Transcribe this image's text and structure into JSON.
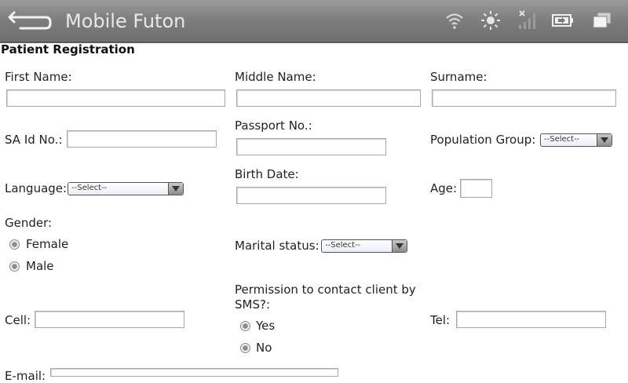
{
  "app": {
    "title": "Mobile Futon"
  },
  "page": {
    "title": "Patient Registration"
  },
  "status_icons": [
    "wifi-icon",
    "brightness-icon",
    "no-signal-icon",
    "battery-charging-icon",
    "recent-apps-icon"
  ],
  "form": {
    "first_name_label": "First Name:",
    "middle_name_label": "Middle Name:",
    "surname_label": "Surname:",
    "sa_id_label": "SA Id No.:",
    "passport_label": "Passport No.:",
    "population_group_label": "Population Group:",
    "population_group_value": "--Select--",
    "language_label": "Language:",
    "language_value": "--Select--",
    "birth_date_label": "Birth Date:",
    "age_label": "Age:",
    "gender_label": "Gender:",
    "gender_options": [
      "Female",
      "Male"
    ],
    "marital_status_label": "Marital status:",
    "marital_status_value": "--Select--",
    "sms_permission_label_line1": "Permission to contact client by",
    "sms_permission_label_line2": "SMS?:",
    "sms_options": [
      "Yes",
      "No"
    ],
    "cell_label": "Cell:",
    "tel_label": "Tel:",
    "email_label": "E-mail:"
  }
}
